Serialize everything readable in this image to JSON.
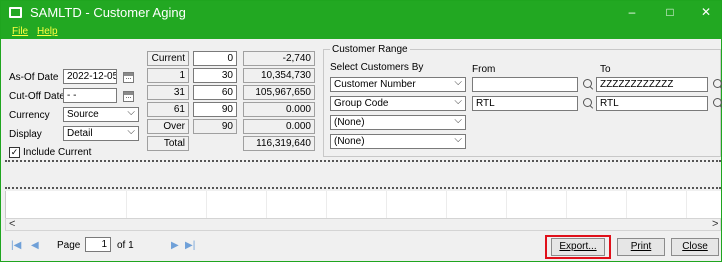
{
  "window": {
    "title": "SAMLTD - Customer Aging",
    "controls": {
      "minimize": "–",
      "maximize": "□",
      "close": "✕"
    },
    "accent_color": "#22a822"
  },
  "menu": {
    "items": [
      "File",
      "Help"
    ]
  },
  "params": {
    "as_of_date_label": "As-Of Date",
    "as_of_date_value": "2022-12-05",
    "cutoff_date_label": "Cut-Off Date",
    "cutoff_date_value": "- -",
    "currency_label": "Currency",
    "currency_value": "Source",
    "display_label": "Display",
    "display_value": "Detail",
    "include_current_label": "Include Current",
    "include_current_checked": "✓"
  },
  "aging": {
    "rows": [
      {
        "label": "Current",
        "days": "0",
        "amount": "-2,740"
      },
      {
        "label": "1",
        "days": "30",
        "amount": "10,354,730"
      },
      {
        "label": "31",
        "days": "60",
        "amount": "105,967,650"
      },
      {
        "label": "61",
        "days": "90",
        "amount": "0.000"
      },
      {
        "label": "Over",
        "days": "90",
        "amount": "0.000"
      }
    ],
    "total_label": "Total",
    "total_amount": "116,319,640"
  },
  "customer_range": {
    "title": "Customer Range",
    "select_by_label": "Select Customers By",
    "from_label": "From",
    "to_label": "To",
    "criteria": [
      {
        "field": "Customer Number",
        "from": "",
        "to": "ZZZZZZZZZZZZ"
      },
      {
        "field": "Group Code",
        "from": "RTL",
        "to": "RTL"
      },
      {
        "field": "(None)"
      },
      {
        "field": "(None)"
      }
    ]
  },
  "pager": {
    "first_icon": "|◀",
    "prev_icon": "◀",
    "page_label": "Page",
    "page_value": "1",
    "of_label": "of 1",
    "next_icon": "▶",
    "last_icon": "▶|"
  },
  "buttons": {
    "export": "Export...",
    "print": "Print",
    "close": "Close"
  },
  "scrollbar": {
    "left_icon": "<",
    "right_icon": ">"
  }
}
